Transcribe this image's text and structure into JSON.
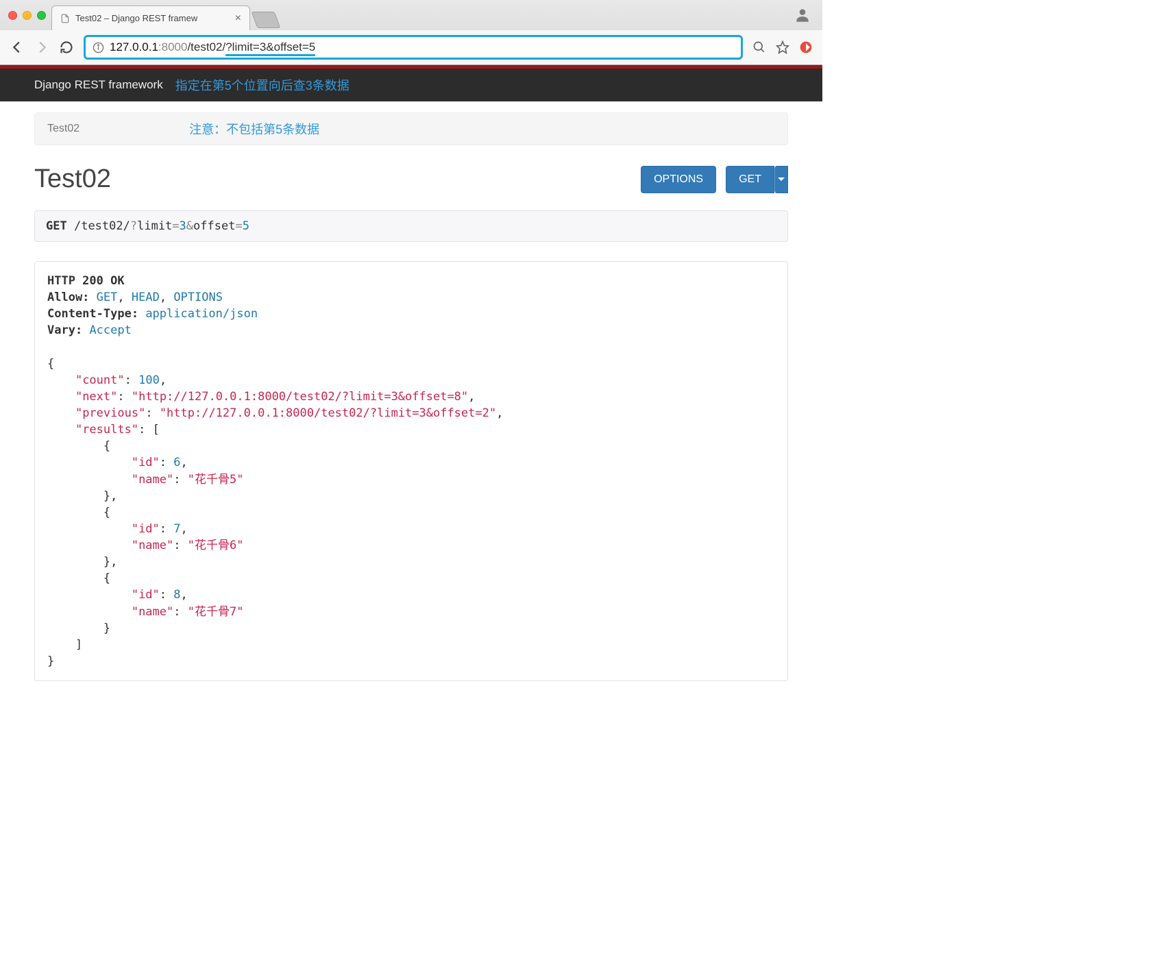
{
  "browser": {
    "tab_title": "Test02 – Django REST framew",
    "url_host": "127.0.0.1",
    "url_port": ":8000",
    "url_path": "/test02/",
    "url_query": "?limit=3&offset=5"
  },
  "navbar": {
    "brand": "Django REST framework",
    "annotation": "指定在第5个位置向后查3条数据"
  },
  "breadcrumb": {
    "text": "Test02",
    "annotation": "注意：不包括第5条数据"
  },
  "page": {
    "title": "Test02",
    "buttons": {
      "options": "OPTIONS",
      "get": "GET"
    }
  },
  "request": {
    "method": "GET",
    "path": "/test02/",
    "q": "?",
    "p1k": "limit",
    "eq": "=",
    "p1v": "3",
    "amp": "&",
    "p2k": "offset",
    "p2v": "5"
  },
  "response": {
    "status_line": "HTTP 200 OK",
    "headers": {
      "allow_label": "Allow:",
      "allow_v1": "GET",
      "allow_v2": "HEAD",
      "allow_v3": "OPTIONS",
      "ctype_label": "Content-Type:",
      "ctype_value": "application/json",
      "vary_label": "Vary:",
      "vary_value": "Accept"
    },
    "body": {
      "count": 100,
      "next": "\"http://127.0.0.1:8000/test02/?limit=3&offset=8\"",
      "previous": "\"http://127.0.0.1:8000/test02/?limit=3&offset=2\"",
      "results": [
        {
          "id": 6,
          "name": "\"花千骨5\""
        },
        {
          "id": 7,
          "name": "\"花千骨6\""
        },
        {
          "id": 8,
          "name": "\"花千骨7\""
        }
      ]
    }
  }
}
